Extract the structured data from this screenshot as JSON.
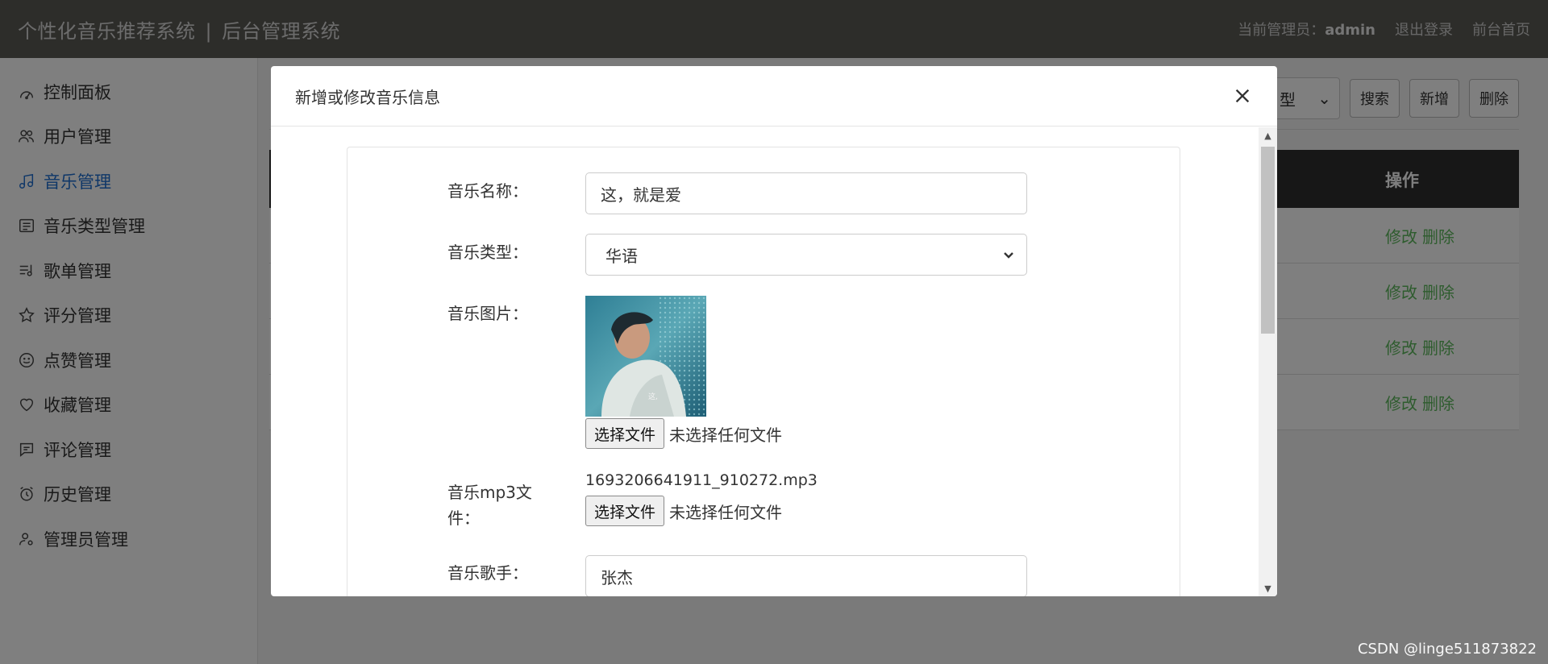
{
  "header": {
    "title": "个性化音乐推荐系统",
    "separator": "|",
    "subtitle": "后台管理系统",
    "admin_label": "当前管理员：",
    "admin_name": "admin",
    "logout": "退出登录",
    "home": "前台首页"
  },
  "sidebar": {
    "items": [
      {
        "label": "控制面板",
        "icon": "dashboard-icon"
      },
      {
        "label": "用户管理",
        "icon": "users-icon"
      },
      {
        "label": "音乐管理",
        "icon": "music-note-icon",
        "active": true
      },
      {
        "label": "音乐类型管理",
        "icon": "list-icon"
      },
      {
        "label": "歌单管理",
        "icon": "playlist-icon"
      },
      {
        "label": "评分管理",
        "icon": "star-icon"
      },
      {
        "label": "点赞管理",
        "icon": "smile-icon"
      },
      {
        "label": "收藏管理",
        "icon": "heart-icon"
      },
      {
        "label": "评论管理",
        "icon": "comment-icon"
      },
      {
        "label": "历史管理",
        "icon": "alarm-clock-icon"
      },
      {
        "label": "管理员管理",
        "icon": "admin-user-icon"
      }
    ]
  },
  "background_page": {
    "filter_select_value": "型",
    "search": "搜索",
    "add": "新增",
    "delete": "删除",
    "table_ops_header": "操作",
    "row_links": {
      "edit": "修改",
      "delete": "删除"
    }
  },
  "modal": {
    "title": "新增或修改音乐信息",
    "fields": {
      "name_label": "音乐名称：",
      "name_value": "这，就是爱",
      "type_label": "音乐类型：",
      "type_value": "华语",
      "image_label": "音乐图片：",
      "file_button": "选择文件",
      "no_file": "未选择任何文件",
      "mp3_label": "音乐mp3文件：",
      "mp3_filename": "1693206641911_910272.mp3",
      "singer_label": "音乐歌手：",
      "singer_value": "张杰"
    }
  },
  "watermark": "CSDN @linge511873822",
  "colors": {
    "header_bg": "#5b5a55",
    "active_blue": "#1f6fd1",
    "link_green": "#5cb85c",
    "table_head": "#2f2f2f"
  }
}
